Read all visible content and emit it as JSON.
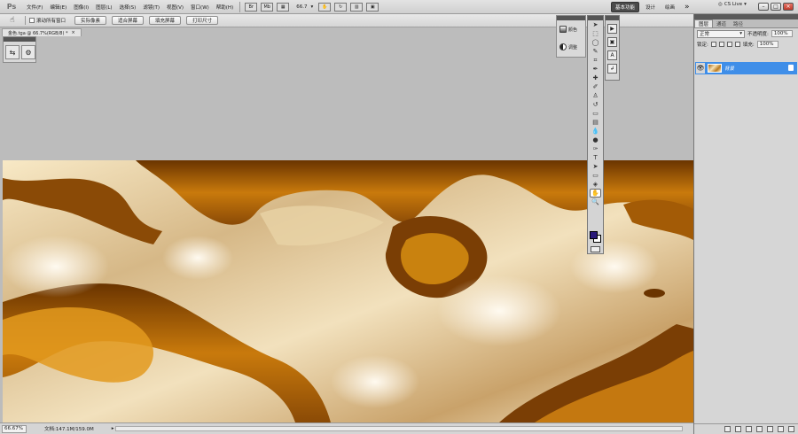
{
  "app": {
    "logo": "Ps",
    "menus": [
      "文件(F)",
      "编辑(E)",
      "图像(I)",
      "图层(L)",
      "选择(S)",
      "滤镜(T)",
      "视图(V)",
      "窗口(W)",
      "帮助(H)"
    ],
    "zoom": "66.7",
    "workspaces": {
      "active": "基本功能",
      "w2": "设计",
      "w3": "绘画",
      "more": "»"
    },
    "cslive": "CS Live"
  },
  "options": {
    "scroll_all": "滚动所有窗口",
    "buttons": [
      "实际像素",
      "适合屏幕",
      "填充屏幕",
      "打印尺寸"
    ]
  },
  "document": {
    "tab": "金色.tga @ 66.7%(RGB/8) *",
    "close": "×"
  },
  "adjust_panel": {
    "item1": "颜色",
    "item2": "调整"
  },
  "layers_panel": {
    "tabs": [
      "图层",
      "通道",
      "路径"
    ],
    "blend_mode": "正常",
    "opacity_label": "不透明度:",
    "opacity": "100%",
    "lock_label": "锁定:",
    "fill_label": "填充:",
    "fill": "100%",
    "layer_name": "背景"
  },
  "status": {
    "zoom": "66.67%",
    "doc": "文档:147.1M/159.0M"
  },
  "colors": {
    "foreground": "#2a1a7a",
    "background": "#ffffff",
    "selection": "#3f8ee8"
  }
}
